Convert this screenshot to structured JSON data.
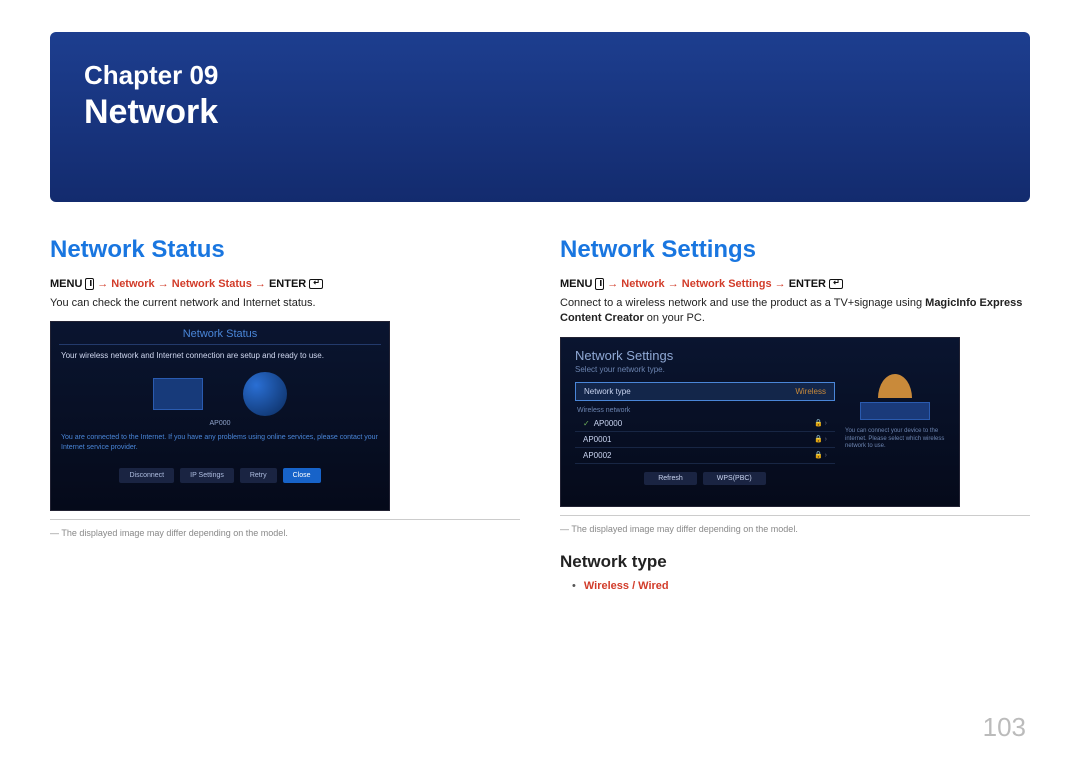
{
  "chapter": {
    "label": "Chapter  09",
    "title": "Network"
  },
  "left": {
    "heading": "Network Status",
    "menu_prefix": "MENU ",
    "menu_red": " → Network → Network Status → ",
    "menu_enter": "ENTER ",
    "body": "You can check the current network and Internet status.",
    "screenshot": {
      "title": "Network Status",
      "line1": "Your wireless network and Internet connection are setup and ready to use.",
      "ap": "AP000",
      "line2": "You are connected to the Internet. If you have any problems using online services, please contact your Internet service provider.",
      "btn1": "Disconnect",
      "btn2": "IP Settings",
      "btn3": "Retry",
      "btn4": "Close"
    },
    "footnote": "― The displayed image may differ depending on the model."
  },
  "right": {
    "heading": "Network Settings",
    "menu_prefix": "MENU ",
    "menu_red": " → Network → Network Settings → ",
    "menu_enter": "ENTER ",
    "body_a": "Connect to a wireless network and use the product as a TV+signage using ",
    "body_b": "MagicInfo Express Content Creator",
    "body_c": " on your PC.",
    "screenshot": {
      "heading": "Network Settings",
      "sub": "Select your network type.",
      "row_label": "Network type",
      "row_value": "Wireless",
      "list_label": "Wireless network",
      "ap0": "AP0000",
      "ap1": "AP0001",
      "ap2": "AP0002",
      "act1": "Refresh",
      "act2": "WPS(PBC)",
      "tip": "You can connect your device to the internet. Please select which wireless network to use."
    },
    "footnote": "― The displayed image may differ depending on the model.",
    "subheading": "Network type",
    "bullet": "Wireless / Wired"
  },
  "page_number": "103"
}
